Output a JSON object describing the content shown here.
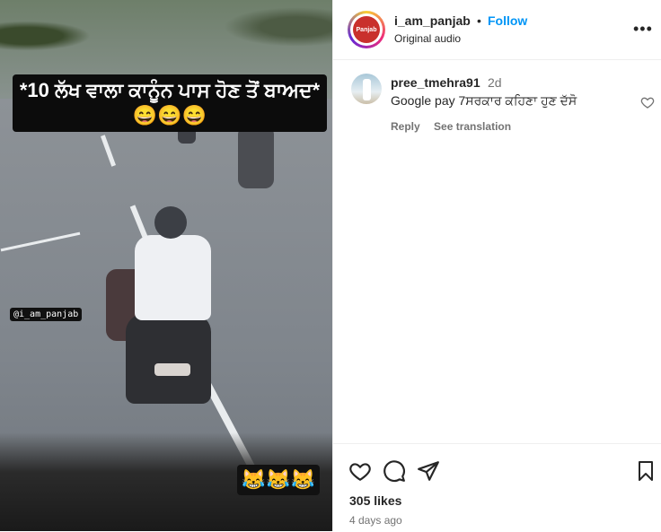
{
  "video": {
    "overlay_caption": "*10 ਲੱਖ ਵਾਲਾ ਕਾਨੂੰਨ ਪਾਸ ਹੋਣ ਤੋਂ ਬਾਅਦ* 😄😄😄",
    "watermark": "@i_am_panjab",
    "emoji_strip": "😹😹😹"
  },
  "header": {
    "avatar_text": "Panjab",
    "username": "i_am_panjab",
    "separator": "•",
    "follow_label": "Follow",
    "subtitle": "Original audio",
    "more_label": "•••"
  },
  "comment": {
    "username": "pree_tmehra91",
    "time": "2d",
    "text": "Google pay 7ਸਰਕਾਰ ਕਹਿਣਾ ਹੁਣ ਦੱਸੋ",
    "reply_label": "Reply",
    "translation_label": "See translation"
  },
  "footer": {
    "likes": "305 likes",
    "posted": "4 days ago",
    "icons": [
      "heart-icon",
      "comment-icon",
      "share-icon",
      "bookmark-icon"
    ]
  }
}
